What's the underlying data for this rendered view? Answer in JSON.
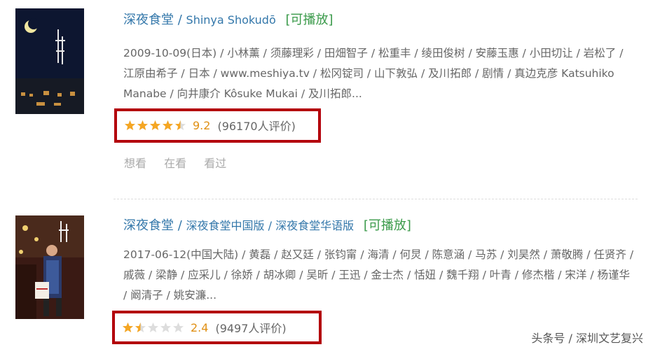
{
  "items": [
    {
      "title": "深夜食堂",
      "separator": "/",
      "subtitle": "Shinya Shokudō",
      "playable": "[可播放]",
      "description": "2009-10-09(日本) / 小林薰 / 须藤理彩 / 田畑智子 / 松重丰 / 绫田俊树 / 安藤玉惠 / 小田切让 / 岩松了 / 江原由希子 / 日本 / www.meshiya.tv / 松冈锭司 / 山下敦弘 / 及川拓郎 / 剧情 / 真边克彦 Katsuhiko Manabe / 向井康介 Kôsuke Mukai / 及川拓郎...",
      "rating": {
        "score": "9.2",
        "score_value": 9.2,
        "votes": "(96170人评价)",
        "stars_filled": 4.5
      },
      "actions": [
        "想看",
        "在看",
        "看过"
      ]
    },
    {
      "title": "深夜食堂",
      "separator": "/",
      "subtitle": "深夜食堂中国版 / 深夜食堂华语版",
      "playable": "[可播放]",
      "description": "2017-06-12(中国大陆) / 黄磊 / 赵又廷 / 张钧甯 / 海清 / 何炅 / 陈意涵 / 马苏 / 刘昊然 / 萧敬腾 / 任贤齐 / 戚薇 / 梁静 / 应采儿 / 徐娇 / 胡冰卿 / 吴昕 / 王迅 / 金士杰 / 恬妞 / 魏千翔 / 叶青 / 修杰楷 / 宋洋 / 杨谨华 / 阚清子 / 姚安濂...",
      "rating": {
        "score": "2.4",
        "score_value": 2.4,
        "votes": "(9497人评价)",
        "stars_filled": 1.5
      }
    }
  ],
  "watermark": "头条号 / 深圳文艺复兴",
  "colors": {
    "title": "#3377aa",
    "playable": "#3a9a4a",
    "star": "#f5a623",
    "star_empty": "#dddddd",
    "highlight_border": "#b3000a"
  }
}
